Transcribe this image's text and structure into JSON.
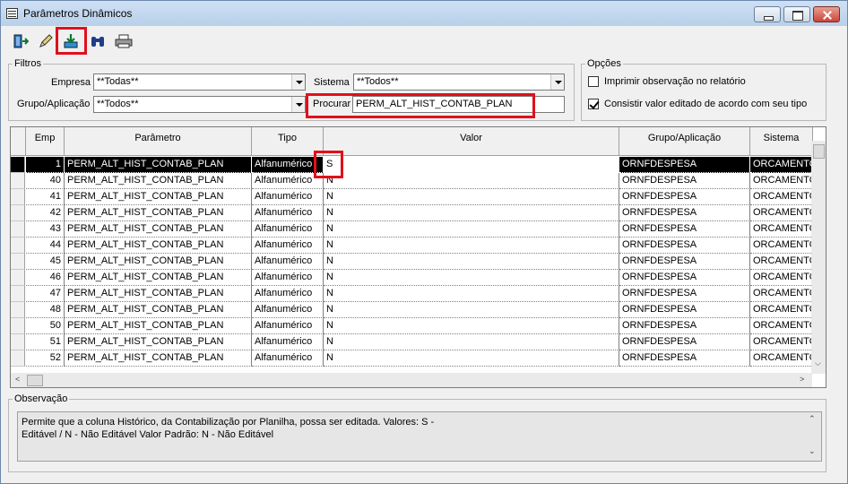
{
  "window": {
    "title": "Parâmetros Dinâmicos"
  },
  "toolbar": {
    "buttons": [
      {
        "icon": "exit-door-icon",
        "label": "Sair"
      },
      {
        "icon": "pencil-icon",
        "label": "Editar"
      },
      {
        "icon": "download-tray-icon",
        "label": "Gravar"
      },
      {
        "icon": "binoculars-icon",
        "label": "Pesquisar"
      },
      {
        "icon": "printer-icon",
        "label": "Imprimir"
      }
    ]
  },
  "filters": {
    "legend": "Filtros",
    "empresa_label": "Empresa",
    "empresa_value": "**Todas**",
    "sistema_label": "Sistema",
    "sistema_value": "**Todos**",
    "grupo_label": "Grupo/Aplicação",
    "grupo_value": "**Todos**",
    "procurar_label": "Procurar",
    "procurar_value": "PERM_ALT_HIST_CONTAB_PLAN"
  },
  "options": {
    "legend": "Opções",
    "imprimir_label": "Imprimir observação no relatório",
    "imprimir_checked": false,
    "consistir_label": "Consistir valor editado de acordo com seu tipo",
    "consistir_checked": true
  },
  "grid": {
    "columns": [
      "Emp",
      "Parâmetro",
      "Tipo",
      "Valor",
      "Grupo/Aplicação",
      "Sistema"
    ],
    "rows": [
      {
        "emp": "1",
        "param": "PERM_ALT_HIST_CONTAB_PLAN",
        "tipo": "Alfanumérico",
        "valor": "S",
        "grupo": "ORNFDESPESA",
        "sistema": "ORCAMENTO"
      },
      {
        "emp": "40",
        "param": "PERM_ALT_HIST_CONTAB_PLAN",
        "tipo": "Alfanumérico",
        "valor": "N",
        "grupo": "ORNFDESPESA",
        "sistema": "ORCAMENTO"
      },
      {
        "emp": "41",
        "param": "PERM_ALT_HIST_CONTAB_PLAN",
        "tipo": "Alfanumérico",
        "valor": "N",
        "grupo": "ORNFDESPESA",
        "sistema": "ORCAMENTO"
      },
      {
        "emp": "42",
        "param": "PERM_ALT_HIST_CONTAB_PLAN",
        "tipo": "Alfanumérico",
        "valor": "N",
        "grupo": "ORNFDESPESA",
        "sistema": "ORCAMENTO"
      },
      {
        "emp": "43",
        "param": "PERM_ALT_HIST_CONTAB_PLAN",
        "tipo": "Alfanumérico",
        "valor": "N",
        "grupo": "ORNFDESPESA",
        "sistema": "ORCAMENTO"
      },
      {
        "emp": "44",
        "param": "PERM_ALT_HIST_CONTAB_PLAN",
        "tipo": "Alfanumérico",
        "valor": "N",
        "grupo": "ORNFDESPESA",
        "sistema": "ORCAMENTO"
      },
      {
        "emp": "45",
        "param": "PERM_ALT_HIST_CONTAB_PLAN",
        "tipo": "Alfanumérico",
        "valor": "N",
        "grupo": "ORNFDESPESA",
        "sistema": "ORCAMENTO"
      },
      {
        "emp": "46",
        "param": "PERM_ALT_HIST_CONTAB_PLAN",
        "tipo": "Alfanumérico",
        "valor": "N",
        "grupo": "ORNFDESPESA",
        "sistema": "ORCAMENTO"
      },
      {
        "emp": "47",
        "param": "PERM_ALT_HIST_CONTAB_PLAN",
        "tipo": "Alfanumérico",
        "valor": "N",
        "grupo": "ORNFDESPESA",
        "sistema": "ORCAMENTO"
      },
      {
        "emp": "48",
        "param": "PERM_ALT_HIST_CONTAB_PLAN",
        "tipo": "Alfanumérico",
        "valor": "N",
        "grupo": "ORNFDESPESA",
        "sistema": "ORCAMENTO"
      },
      {
        "emp": "50",
        "param": "PERM_ALT_HIST_CONTAB_PLAN",
        "tipo": "Alfanumérico",
        "valor": "N",
        "grupo": "ORNFDESPESA",
        "sistema": "ORCAMENTO"
      },
      {
        "emp": "51",
        "param": "PERM_ALT_HIST_CONTAB_PLAN",
        "tipo": "Alfanumérico",
        "valor": "N",
        "grupo": "ORNFDESPESA",
        "sistema": "ORCAMENTO"
      },
      {
        "emp": "52",
        "param": "PERM_ALT_HIST_CONTAB_PLAN",
        "tipo": "Alfanumérico",
        "valor": "N",
        "grupo": "ORNFDESPESA",
        "sistema": "ORCAMENTO"
      }
    ]
  },
  "observacao": {
    "legend": "Observação",
    "text_line1": "Permite que a coluna Histórico, da Contabilização por Planilha, possa ser editada. Valores: S -",
    "text_line2": "Editável / N - Não Editável Valor Padrão: N - Não Editável"
  }
}
